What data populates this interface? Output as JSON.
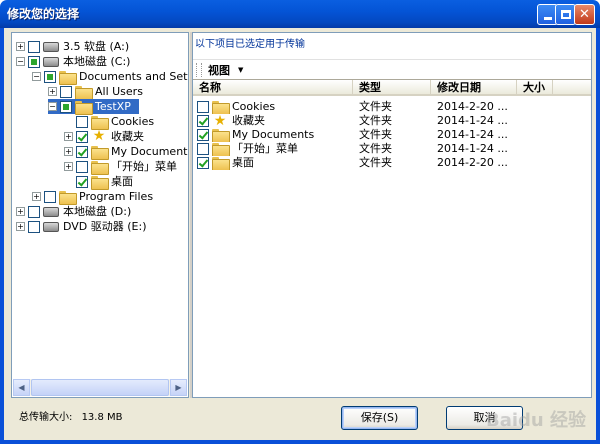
{
  "window": {
    "title": "修改您的选择"
  },
  "tree": {
    "items": [
      {
        "label": "3.5 软盘 (A:)",
        "level": 0,
        "expander": "+",
        "check": "none",
        "icon": "floppy-drive-icon"
      },
      {
        "label": "本地磁盘 (C:)",
        "level": 0,
        "expander": "-",
        "check": "partial",
        "icon": "hard-drive-icon"
      },
      {
        "label": "Documents and Settings",
        "level": 1,
        "expander": "-",
        "check": "partial",
        "icon": "folder-icon"
      },
      {
        "label": "All Users",
        "level": 2,
        "expander": "+",
        "check": "none",
        "icon": "folder-icon"
      },
      {
        "label": "TestXP",
        "level": 2,
        "expander": "-",
        "check": "partial",
        "icon": "folder-icon",
        "selected": true
      },
      {
        "label": "Cookies",
        "level": 3,
        "expander": "",
        "check": "none",
        "icon": "folder-icon"
      },
      {
        "label": "收藏夹",
        "level": 3,
        "expander": "+",
        "check": "checked",
        "icon": "star-icon"
      },
      {
        "label": "My Documents",
        "level": 3,
        "expander": "+",
        "check": "checked",
        "icon": "folder-icon"
      },
      {
        "label": "「开始」菜单",
        "level": 3,
        "expander": "+",
        "check": "none",
        "icon": "folder-icon"
      },
      {
        "label": "桌面",
        "level": 3,
        "expander": "",
        "check": "checked",
        "icon": "folder-icon"
      },
      {
        "label": "Program Files",
        "level": 1,
        "expander": "+",
        "check": "none",
        "icon": "folder-icon"
      },
      {
        "label": "本地磁盘 (D:)",
        "level": 0,
        "expander": "+",
        "check": "none",
        "icon": "hard-drive-icon"
      },
      {
        "label": "DVD 驱动器 (E:)",
        "level": 0,
        "expander": "+",
        "check": "none",
        "icon": "dvd-drive-icon"
      }
    ]
  },
  "right": {
    "info_text": "以下项目已选定用于传输",
    "view_label": "视图",
    "columns": [
      "名称",
      "类型",
      "修改日期",
      "大小"
    ],
    "rows": [
      {
        "name": "Cookies",
        "type": "文件夹",
        "date": "2014-2-20 ...",
        "check": "none",
        "icon": "folder-icon"
      },
      {
        "name": "收藏夹",
        "type": "文件夹",
        "date": "2014-1-24 ...",
        "check": "checked",
        "icon": "star-icon"
      },
      {
        "name": "My Documents",
        "type": "文件夹",
        "date": "2014-1-24 ...",
        "check": "checked",
        "icon": "folder-icon"
      },
      {
        "name": "「开始」菜单",
        "type": "文件夹",
        "date": "2014-1-24 ...",
        "check": "none",
        "icon": "folder-icon"
      },
      {
        "name": "桌面",
        "type": "文件夹",
        "date": "2014-2-20 ...",
        "check": "checked",
        "icon": "folder-icon"
      }
    ]
  },
  "footer": {
    "total_label": "总传输大小:",
    "total_value": "13.8 MB",
    "save_label": "保存(S)",
    "cancel_label": "取消"
  },
  "watermark": "Baidu 经验",
  "colors": {
    "title_bar": "#0454d6",
    "selection": "#316ac5",
    "dialog_face": "#ece9d8",
    "info_text": "#003399"
  }
}
